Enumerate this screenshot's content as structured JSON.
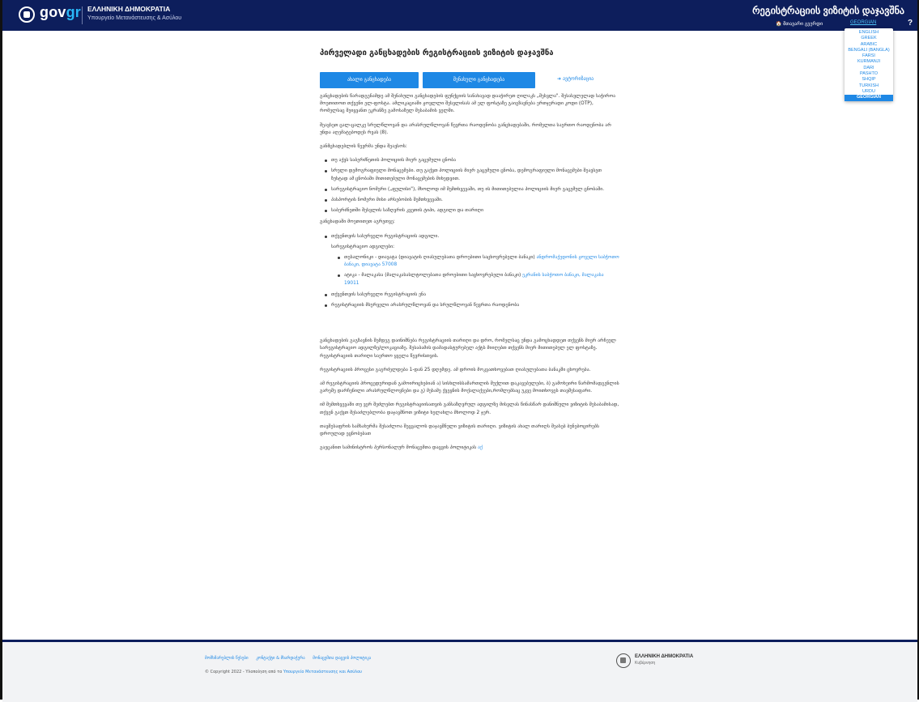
{
  "header": {
    "logo_prefix": "gov",
    "logo_suffix": "gr",
    "republic": "ΕΛΛΗΝΙΚΗ ΔΗΜΟΚΡΑΤΙΑ",
    "ministry": "Υπουργείο Μετανάστευσης & Ασύλου",
    "title": "რეგისტრაციის ვიზიტის დაჯავშნა",
    "home_label": "მთავარი გვერდი",
    "current_language": "GEORGIAN",
    "help_label": "?"
  },
  "languages": [
    "ENGLISH",
    "GREEK",
    "ARABIC",
    "BENGALI (BANGLA)",
    "FARSI",
    "KURMANJI",
    "DARI",
    "PASHTO",
    "SHQIP",
    "TURKISH",
    "URDU",
    "GEORGIAN"
  ],
  "selected_language": "GEORGIAN",
  "main": {
    "title": "პირველადი განცხადების რეგისტრაციის ვიზიტის დაჯავშნა",
    "new_application_button": "ახალი განცხადება",
    "submitted_application_button": "შენახული განცხადება",
    "login_link": "ავტორიზაცია",
    "para1": "განცხადების წარადგენამდე ამ შენახული განცხადების ფუნქციის სანახავად დააჭირეთ ღილაკს „შესვლა\". შესასვლელად საჭიროა მოეთითოთ თქვენი ელ-ფოსტა. ამლიკაციაში ჟოვლლი შესვლისას ამ ელ ფოსტაზე გაიგზავნება ერთჯერადი კოდი (OTP), რომელსაც შეიყვანთ ეკრანზე გამოსაზულ შესაბამის ველში.",
    "para2": "შეავსეთ ცალ-ცალკე სრულწლოვან და არასრულწლოვან წევრთა რაოდენობა განცხადებაში, რომელთა საერთო რაოდენობა არ უნდა აღემატებოდეს რვას (8).",
    "para3": "განმცხადებლის წევრმა უნდა შეავსოს:",
    "list1": [
      "თუ აქვს საბერძნეთის პოლიციის მიერ გაცემული ცნობა",
      "სრული დემოგრაფიული მონაცემები. თუ გაქვთ პოლიციის მიერ გაცემული ცნობა, დემოგრაფიული მონაცემები შეავსეთ ზუსტად ამ ცნობაში მითითებული მონაცემების მიხედვით.",
      "სარეგისტრაციო ნომერი („ფულისი\"), მხოლოდ იმ შემთხვევაში, თუ ის მითითებულია პოლიციის მიერ გაცემულ ცნობაში.",
      "პასპორტის ნომერი მისი არსებობის შემთხვევაში.",
      "საბერძნეთში შესვლის საზღვრის კვეთის ტიპი, ადგილი და თარიღი"
    ],
    "para4": "განცხადაში მოეთითეთ აგრეთვე:",
    "list2_item1": "თქვენთვის სასურველი რეგისტრაციის ადგილი.",
    "sub_label": "სარეგისტრაციო ადგილები:",
    "sub_item1_text": "თესალონიკი - დიავატა (დიავატის ღიასულებათა დროებითი საცხოვრებელი ბანაკი)",
    "sub_item1_link": "ანდრომაქედონის ჟოველი საბჭოთო ბანაკი, დიავატა 57008",
    "sub_item2_text": "ატიკა - მალაკასა (მალაკასასლტოლებათა დროებითი საცხოვრებელი ბანაკი)",
    "sub_item2_link": "ეკრანის საბჭოთო ბანაკი, მალაკასა 19011",
    "list2_item2": "თქვენთვის სასურველი რეგისტრაციის ენა",
    "list2_item3": "რეგისტრაციის მსურველი არასრულწლოვან და სრულწლოვან წევრთა რაოდენობა",
    "para5": "განცხადების გაგზავნის შემდეგ დაინიშნება რეგისტრაციის თარიღი და დრო, რომელსაც უნდა გამოცხადდეთ თქვენს მიერ არჩეულ სარეგისტრაციო ადგილზე/ლოკაციაზე. შესაბამის დამადასტურებელ აქტს მიიღებთ თქვენს მიერ მითითებულ ელ ფოსტაზე. რეგისტრაციის თარიღი საერთო ყველა წევრისთვის.",
    "para6": "რეგისტრაციის პროცესი გაგრძელდება 1-დან 25 დღემდე. ამ დროის მოკვათხოვებათ ღიასულებათა ბანაკში ცხოვრება.",
    "para7": "ამ რეგისტრაციის პროცედურიდან გამოირიცხებიან ა) სისხლისსამართლის შუქლით დაკავებულები, ბ) გამოხეირი წარმომადგენლის გარეშე დარჩენილი არასრულწლოვნები და გ) მესამე ქვეყნის მოქალაქეები,რომლებსაც უკვე მოითხოვეს თავშესაფარი.",
    "para8": "იმ შემთხვევაში თუ ვერ შეძლებთ რეგისტრაციისათვის განსაზღვრულ ადგილზე მისვლას წინასწარ დანიშნული ვიზიტის შესაბამისად, თქვენ გაქვთ შესაძლებლობა დაჯავშნოთ ვიზიტი ხელახლა მხოლოდ 2 ჯერ.",
    "para9": "თავშესაფრის სამსახურმა შესაძლოა შეცვალოს დაჯავშნული ვიზიტის თარიღი. ვიზიტის ახალ თარიღს შეასებ ბუნებოცირებს დროულად ეცნობებათ",
    "para10_text": "გაეცანით სამინისტროს პერსონალურ მონაცემთა დაცვის პოლიტიკას",
    "para10_link": "აქ"
  },
  "footer": {
    "link1": "მომხმარებლის წესები",
    "link2": "კონტაქტი & მხარდაჭერა",
    "link3": "მონაცემთა დაცვის პოლიტიკა",
    "copyright_prefix": "© Copyright 2022 - Υλοποίηση από το",
    "copyright_link": "Υπουργείο Μετανάστευσης και Ασύλου",
    "republic": "ΕΛΛΗΝΙΚΗ ΔΗΜΟΚΡΑΤΙΑ",
    "gov": "Κυβέρνηση"
  }
}
